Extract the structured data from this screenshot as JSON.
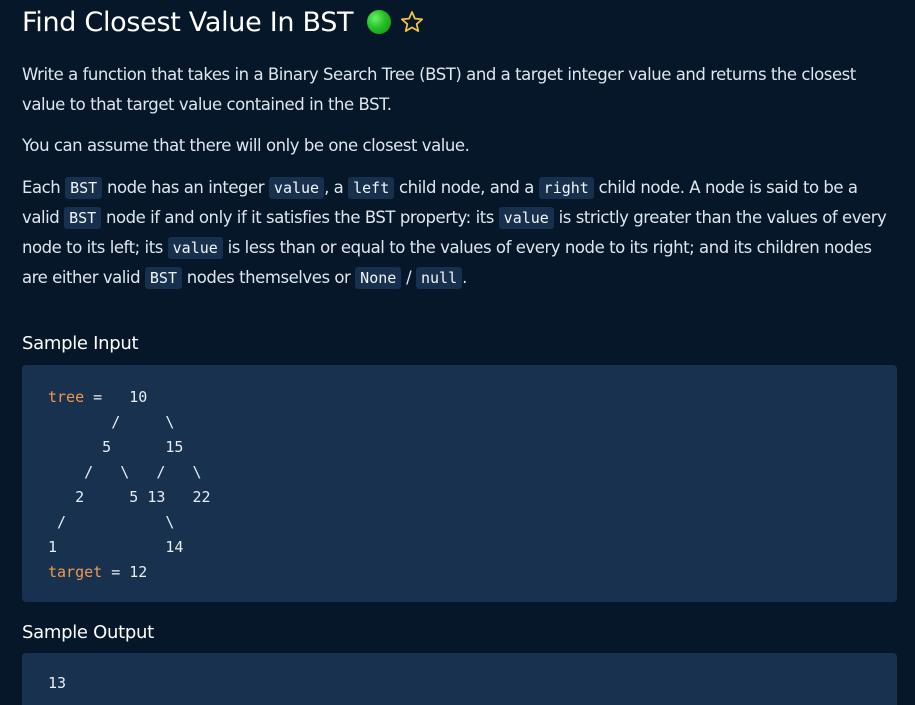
{
  "problem": {
    "title": "Find Closest Value In BST",
    "difficulty_color": "#22c322",
    "favorite_icon": "star-outline-icon"
  },
  "description": {
    "p1": "Write a function that takes in a Binary Search Tree (BST) and a target integer value and returns the closest value to that target value contained in the BST.",
    "p2": "You can assume that there will only be one closest value.",
    "p3": {
      "t1": "Each ",
      "c1": "BST",
      "t2": " node has an integer ",
      "c2": "value",
      "t3": ", a ",
      "c3": "left",
      "t4": " child node, and a ",
      "c4": "right",
      "t5": " child node. A node is said to be a valid ",
      "c5": "BST",
      "t6": " node if and only if it satisfies the BST property: its ",
      "c6": "value",
      "t7": " is strictly greater than the values of every node to its left; its ",
      "c7": "value",
      "t8": " is less than or equal to the values of every node to its right; and its children nodes are either valid ",
      "c8": "BST",
      "t9": " nodes themselves or ",
      "c9": "None",
      "t10": " / ",
      "c10": "null",
      "t11": "."
    }
  },
  "sample_input": {
    "heading": "Sample Input",
    "tree_var": "tree",
    "tree_eq": " =   10",
    "tree_lines": [
      "       /     \\",
      "      5      15",
      "    /   \\   /   \\",
      "   2     5 13   22",
      " /           \\",
      "1            14"
    ],
    "target_var": "target",
    "target_eq": " = 12"
  },
  "sample_output": {
    "heading": "Sample Output",
    "value": "13"
  },
  "colors": {
    "background": "#051729",
    "code_background": "#17314f",
    "keyword": "#f0984a"
  }
}
